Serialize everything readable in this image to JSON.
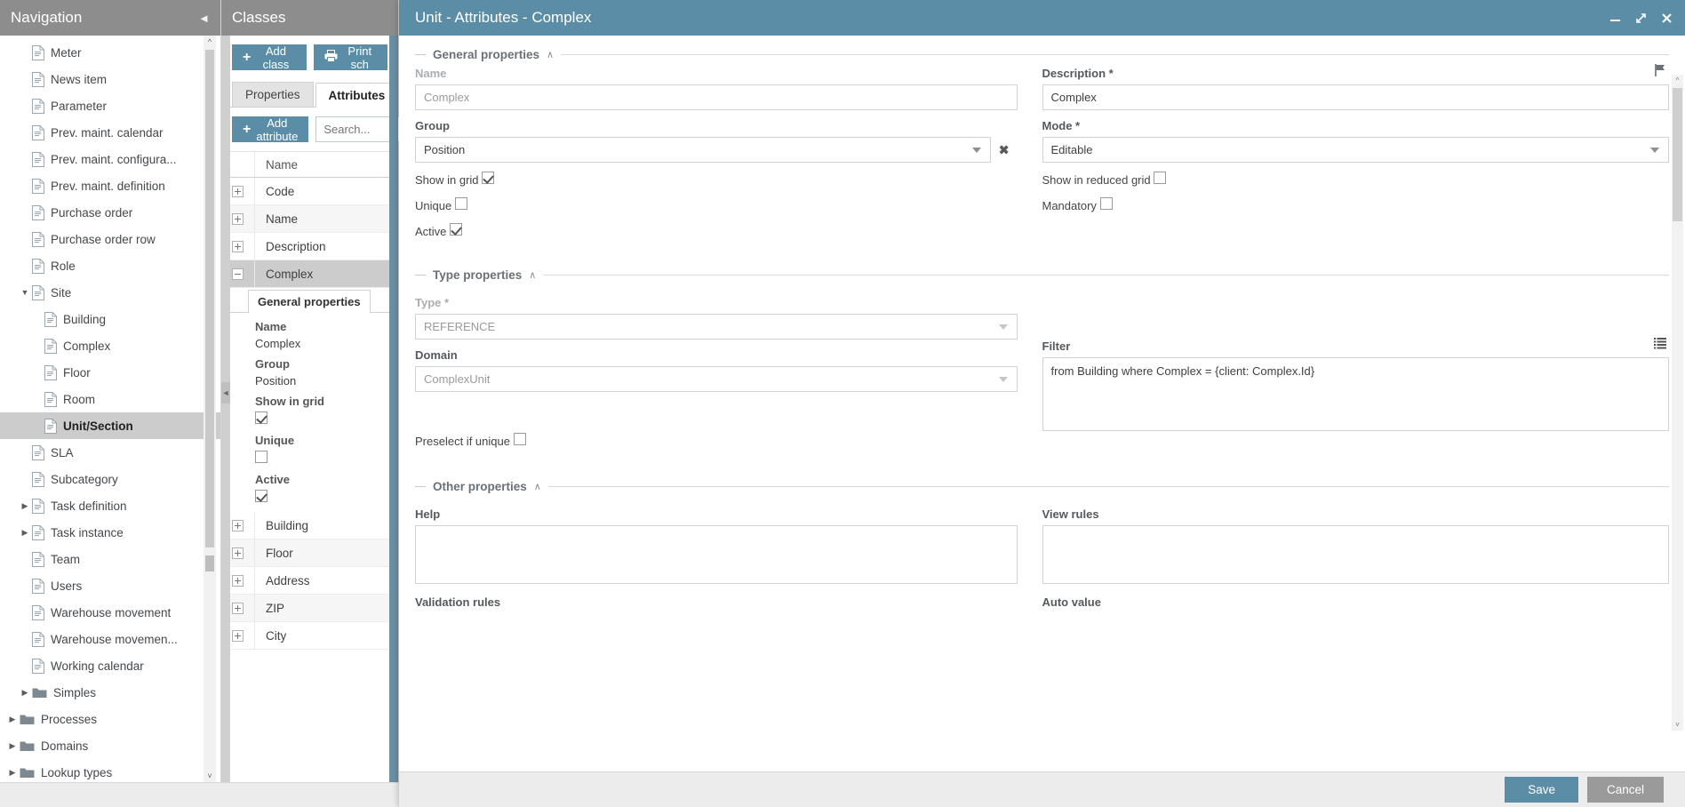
{
  "navigation": {
    "title": "Navigation",
    "collapse_icon": "chevron-left-icon",
    "items": [
      {
        "label": "Meter",
        "icon": "document-icon",
        "indent": 1,
        "twisty": "",
        "selected": false
      },
      {
        "label": "News item",
        "icon": "document-icon",
        "indent": 1,
        "twisty": "",
        "selected": false
      },
      {
        "label": "Parameter",
        "icon": "document-icon",
        "indent": 1,
        "twisty": "",
        "selected": false
      },
      {
        "label": "Prev. maint. calendar",
        "icon": "document-icon",
        "indent": 1,
        "twisty": "",
        "selected": false
      },
      {
        "label": "Prev. maint. configura...",
        "icon": "document-icon",
        "indent": 1,
        "twisty": "",
        "selected": false
      },
      {
        "label": "Prev. maint. definition",
        "icon": "document-icon",
        "indent": 1,
        "twisty": "",
        "selected": false
      },
      {
        "label": "Purchase order",
        "icon": "document-icon",
        "indent": 1,
        "twisty": "",
        "selected": false
      },
      {
        "label": "Purchase order row",
        "icon": "document-icon",
        "indent": 1,
        "twisty": "",
        "selected": false
      },
      {
        "label": "Role",
        "icon": "document-icon",
        "indent": 1,
        "twisty": "",
        "selected": false
      },
      {
        "label": "Site",
        "icon": "document-icon",
        "indent": 1,
        "twisty": "down",
        "selected": false
      },
      {
        "label": "Building",
        "icon": "document-icon",
        "indent": 2,
        "twisty": "",
        "selected": false
      },
      {
        "label": "Complex",
        "icon": "document-icon",
        "indent": 2,
        "twisty": "",
        "selected": false
      },
      {
        "label": "Floor",
        "icon": "document-icon",
        "indent": 2,
        "twisty": "",
        "selected": false
      },
      {
        "label": "Room",
        "icon": "document-icon",
        "indent": 2,
        "twisty": "",
        "selected": false
      },
      {
        "label": "Unit/Section",
        "icon": "document-icon",
        "indent": 2,
        "twisty": "",
        "selected": true
      },
      {
        "label": "SLA",
        "icon": "document-icon",
        "indent": 1,
        "twisty": "",
        "selected": false
      },
      {
        "label": "Subcategory",
        "icon": "document-icon",
        "indent": 1,
        "twisty": "",
        "selected": false
      },
      {
        "label": "Task definition",
        "icon": "document-icon",
        "indent": 1,
        "twisty": "right",
        "selected": false
      },
      {
        "label": "Task instance",
        "icon": "document-icon",
        "indent": 1,
        "twisty": "right",
        "selected": false
      },
      {
        "label": "Team",
        "icon": "document-icon",
        "indent": 1,
        "twisty": "",
        "selected": false
      },
      {
        "label": "Users",
        "icon": "document-icon",
        "indent": 1,
        "twisty": "",
        "selected": false
      },
      {
        "label": "Warehouse movement",
        "icon": "document-icon",
        "indent": 1,
        "twisty": "",
        "selected": false
      },
      {
        "label": "Warehouse movemen...",
        "icon": "document-icon",
        "indent": 1,
        "twisty": "",
        "selected": false
      },
      {
        "label": "Working calendar",
        "icon": "document-icon",
        "indent": 1,
        "twisty": "",
        "selected": false
      },
      {
        "label": "Simples",
        "icon": "folder-icon",
        "indent": 1,
        "twisty": "right",
        "selected": false
      },
      {
        "label": "Processes",
        "icon": "folder-icon",
        "indent": 0,
        "twisty": "right",
        "selected": false
      },
      {
        "label": "Domains",
        "icon": "folder-icon",
        "indent": 0,
        "twisty": "right",
        "selected": false
      },
      {
        "label": "Lookup types",
        "icon": "folder-icon",
        "indent": 0,
        "twisty": "right",
        "selected": false
      }
    ]
  },
  "classes": {
    "title": "Classes",
    "add_class_label": "Add class",
    "print_schema_label": "Print sch",
    "tabs": [
      {
        "label": "Properties",
        "active": false
      },
      {
        "label": "Attributes",
        "active": true
      }
    ],
    "add_attribute_label": "Add attribute",
    "search_placeholder": "Search...",
    "grid_header_name": "Name",
    "rows": [
      {
        "name": "Code",
        "expanded": false,
        "selected": false
      },
      {
        "name": "Name",
        "expanded": false,
        "selected": false
      },
      {
        "name": "Description",
        "expanded": false,
        "selected": false
      },
      {
        "name": "Complex",
        "expanded": true,
        "selected": true
      }
    ],
    "rows_after": [
      {
        "name": "Building",
        "expanded": false,
        "selected": false
      },
      {
        "name": "Floor",
        "expanded": false,
        "selected": false
      },
      {
        "name": "Address",
        "expanded": false,
        "selected": false
      },
      {
        "name": "ZIP",
        "expanded": false,
        "selected": false
      },
      {
        "name": "City",
        "expanded": false,
        "selected": false
      }
    ],
    "inline_detail": {
      "tab_label": "General properties",
      "fields": [
        {
          "label": "Name",
          "value": "Complex",
          "type": "text"
        },
        {
          "label": "Group",
          "value": "Position",
          "type": "text"
        },
        {
          "label": "Show in grid",
          "value": "",
          "type": "checkbox",
          "checked": true
        },
        {
          "label": "Unique",
          "value": "",
          "type": "checkbox",
          "checked": false
        },
        {
          "label": "Active",
          "value": "",
          "type": "checkbox",
          "checked": true
        }
      ]
    }
  },
  "dialog": {
    "title": "Unit - Attributes - Complex",
    "window_controls": [
      {
        "name": "minimize-icon",
        "glyph": "–"
      },
      {
        "name": "maximize-icon",
        "glyph": "↗"
      },
      {
        "name": "close-icon",
        "glyph": "✕"
      }
    ],
    "sections": {
      "general": {
        "title": "General properties",
        "caret": "∧",
        "name": {
          "label": "Name",
          "value": "Complex",
          "disabled": true
        },
        "description": {
          "label": "Description *",
          "value": "Complex",
          "flag_icon": "flag-icon"
        },
        "group": {
          "label": "Group",
          "value": "Position",
          "clear": "✖"
        },
        "mode": {
          "label": "Mode *",
          "value": "Editable"
        },
        "show_in_grid": {
          "label": "Show in grid",
          "checked": true
        },
        "show_in_reduced_grid": {
          "label": "Show in reduced grid",
          "checked": false
        },
        "unique": {
          "label": "Unique",
          "checked": false
        },
        "mandatory": {
          "label": "Mandatory",
          "checked": false
        },
        "active": {
          "label": "Active",
          "checked": true
        }
      },
      "type": {
        "title": "Type properties",
        "caret": "∧",
        "type": {
          "label": "Type *",
          "value": "REFERENCE",
          "disabled": true
        },
        "domain": {
          "label": "Domain",
          "value": "ComplexUnit",
          "disabled": true
        },
        "filter": {
          "label": "Filter",
          "value": "from Building where Complex = {client: Complex.Id}",
          "list_icon": "list-icon"
        },
        "preselect": {
          "label": "Preselect if unique",
          "checked": false
        }
      },
      "other": {
        "title": "Other properties",
        "caret": "∧",
        "help": {
          "label": "Help",
          "value": ""
        },
        "view_rules": {
          "label": "View rules",
          "value": ""
        },
        "validation_rules": {
          "label": "Validation rules",
          "value": ""
        },
        "auto_value": {
          "label": "Auto value",
          "value": ""
        }
      }
    },
    "footer": {
      "save_label": "Save",
      "cancel_label": "Cancel"
    }
  },
  "colors": {
    "accent": "#5b8ea6",
    "panel_header": "#8d8d8d",
    "selection": "#cccccc",
    "footer_bg": "#ececec"
  }
}
